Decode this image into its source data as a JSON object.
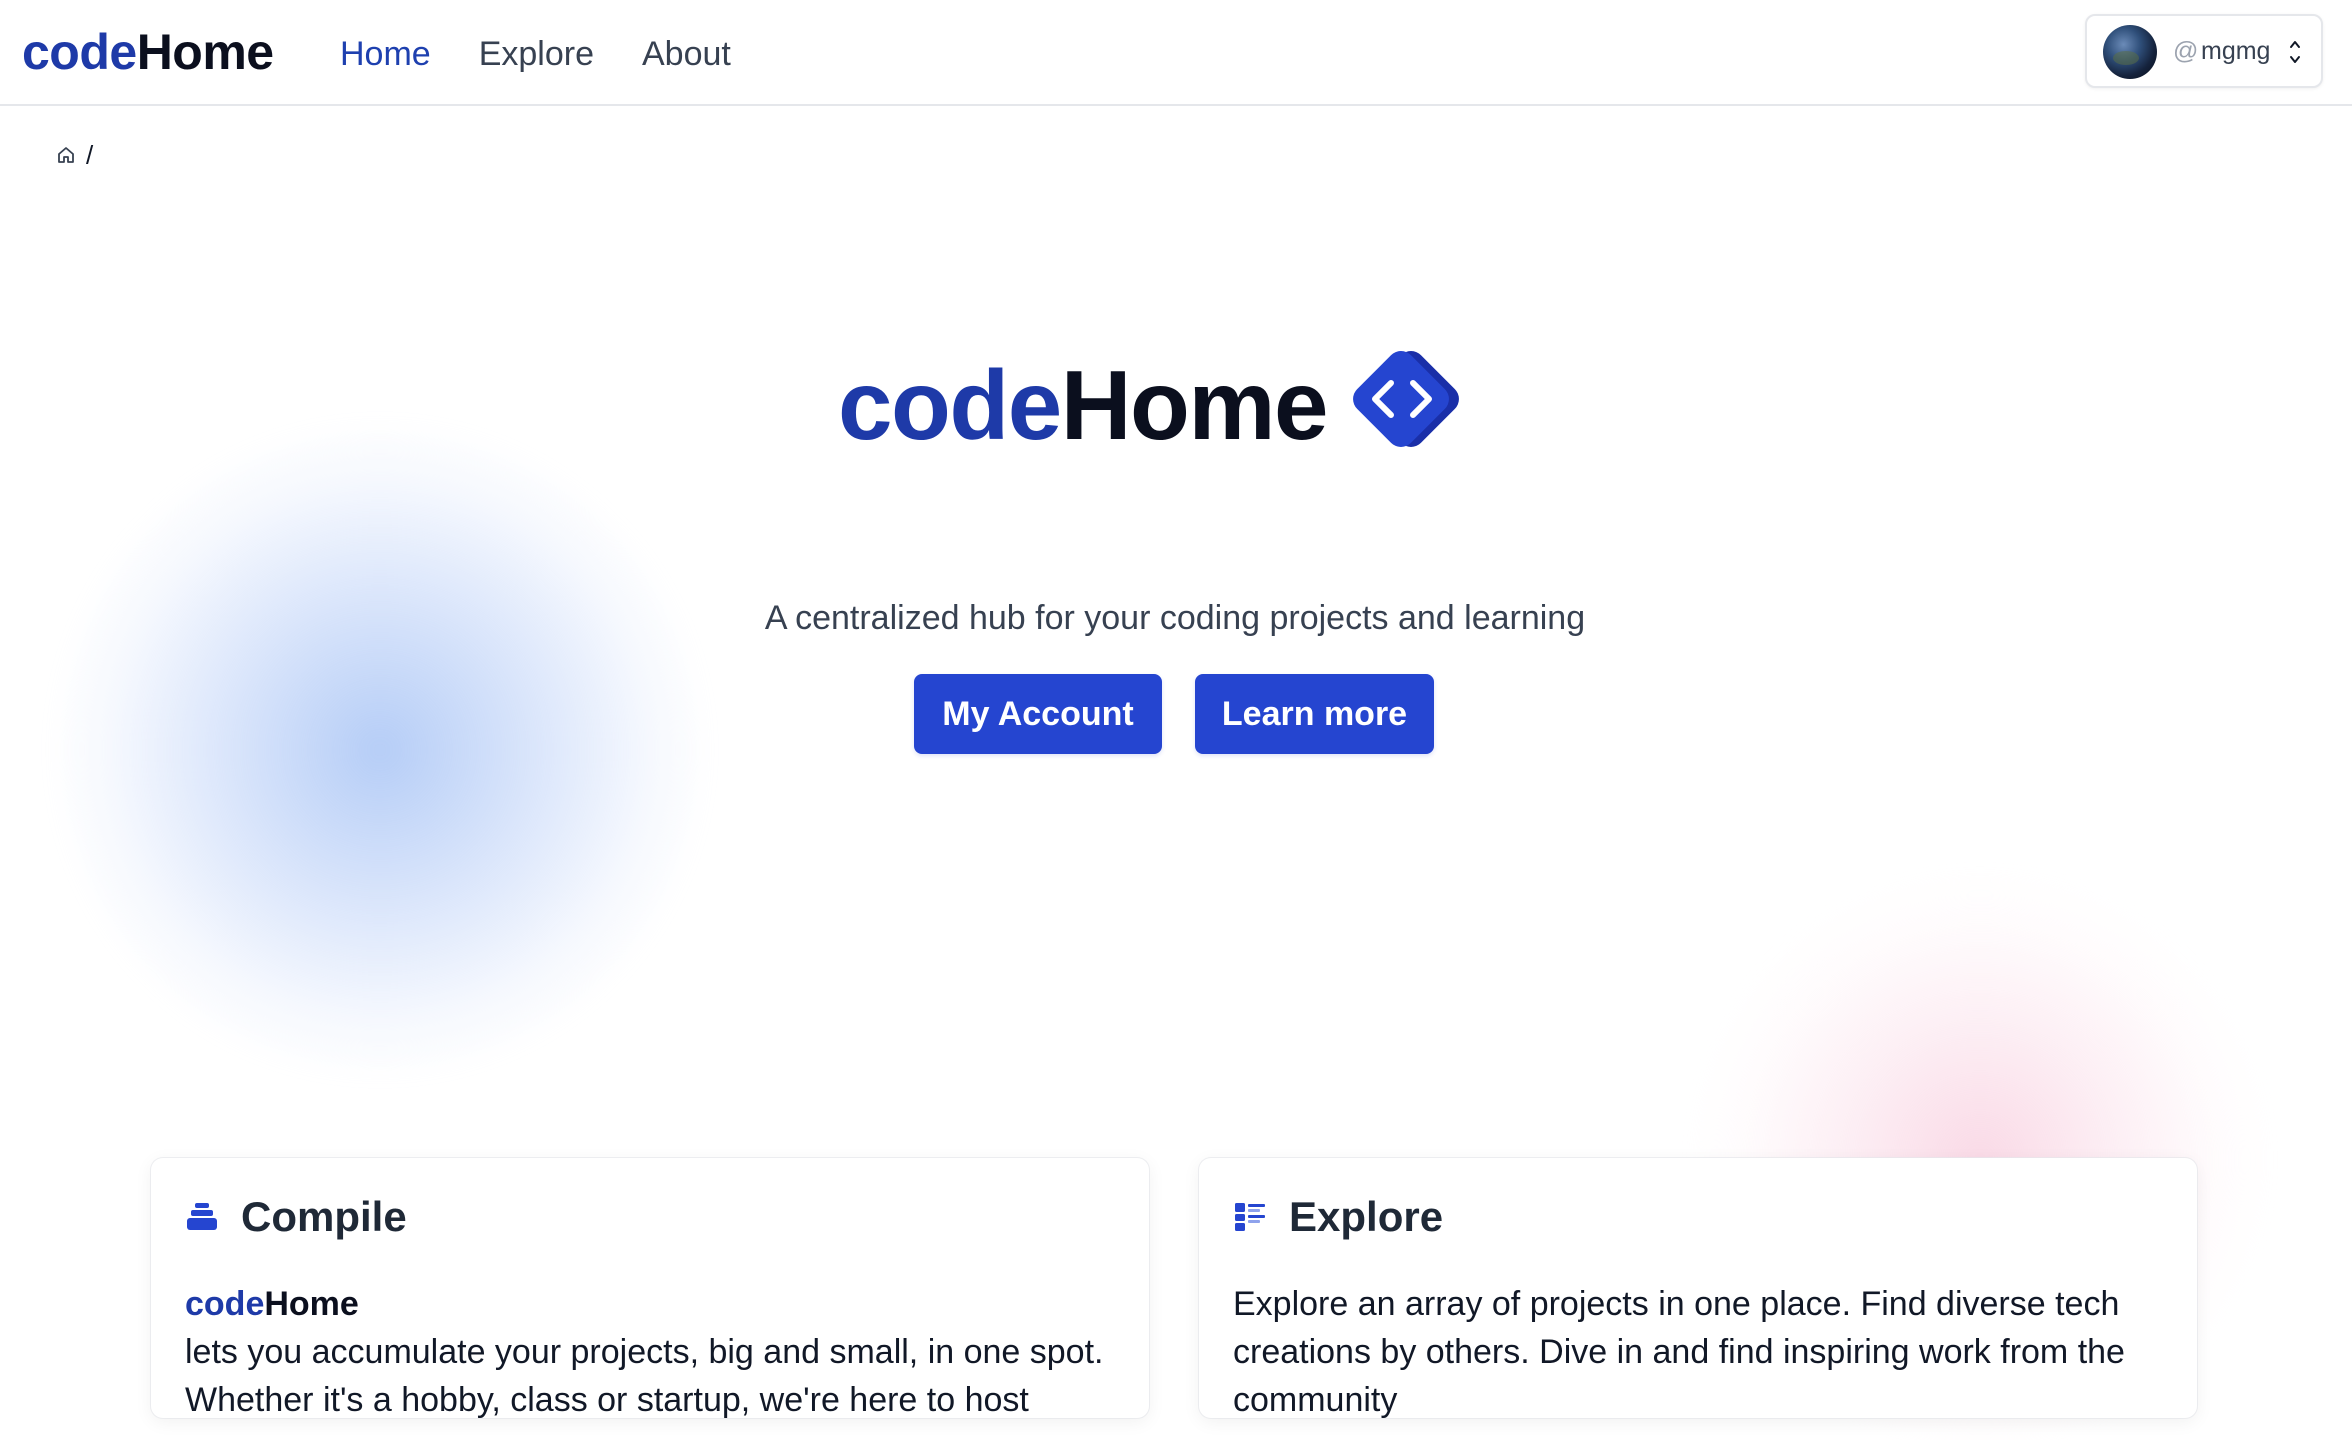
{
  "header": {
    "brand": {
      "code": "code",
      "home": "Home"
    },
    "nav": [
      {
        "label": "Home",
        "active": true
      },
      {
        "label": "Explore",
        "active": false
      },
      {
        "label": "About",
        "active": false
      }
    ],
    "user": {
      "at": "@",
      "username": "mgmg"
    }
  },
  "breadcrumb": {
    "separator": "/"
  },
  "hero": {
    "brand": {
      "code": "code",
      "home": "Home"
    },
    "tagline": "A centralized hub for your coding projects and learning",
    "buttons": {
      "account": "My Account",
      "learn": "Learn more"
    }
  },
  "cards": {
    "compile": {
      "title": "Compile",
      "brand": {
        "code": "code",
        "home": "Home"
      },
      "text": "lets you accumulate your projects, big and small, in one spot. Whether it's a hobby, class or startup, we're here to host"
    },
    "explore": {
      "title": "Explore",
      "text": "Explore an array of projects in one place. Find diverse tech creations by others. Dive in and find inspiring work from the community"
    }
  },
  "colors": {
    "primary": "#2545d0",
    "brand_code": "#1e3aa8",
    "brand_home": "#0b0f1e",
    "nav_active": "#1e40af"
  },
  "icons": {
    "home": "home-icon",
    "code_diamond": "code-diamond-icon",
    "compile": "layers-stack-icon",
    "explore": "list-grid-icon",
    "chevrons": "chevron-up-down-icon"
  }
}
